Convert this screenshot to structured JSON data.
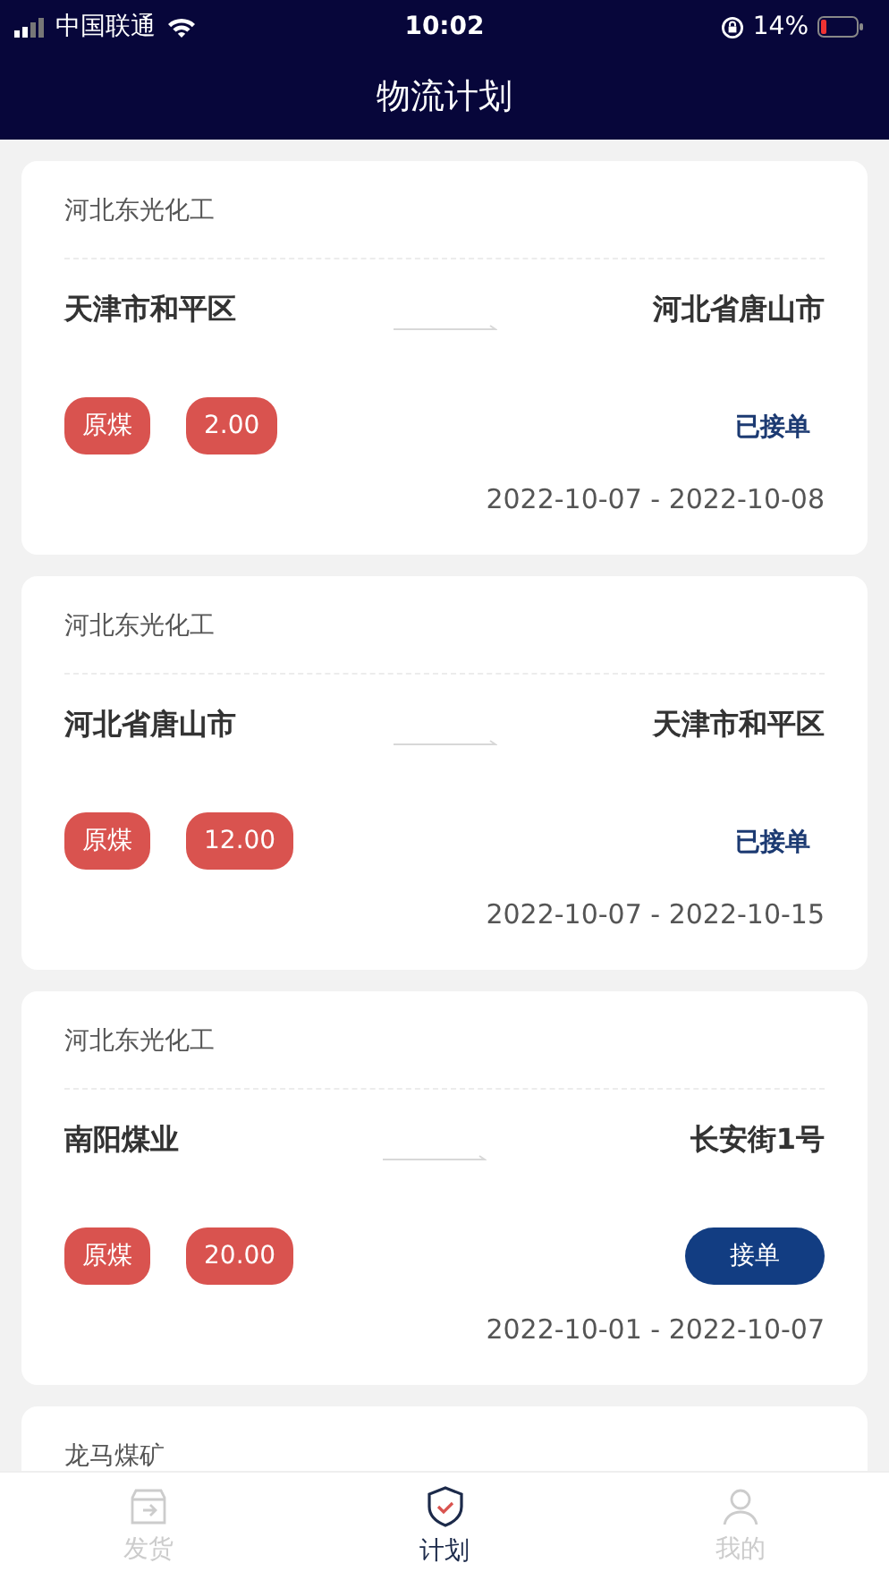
{
  "status_bar": {
    "carrier": "中国联通",
    "time": "10:02",
    "battery": "14%"
  },
  "header": {
    "title": "物流计划"
  },
  "plans": [
    {
      "company": "河北东光化工",
      "origin": "天津市和平区",
      "destination": "河北省唐山市",
      "cargo": "原煤",
      "amount": "2.00",
      "action": {
        "kind": "status",
        "label": "已接单"
      },
      "dates": "2022-10-07 - 2022-10-08"
    },
    {
      "company": "河北东光化工",
      "origin": "河北省唐山市",
      "destination": "天津市和平区",
      "cargo": "原煤",
      "amount": "12.00",
      "action": {
        "kind": "status",
        "label": "已接单"
      },
      "dates": "2022-10-07 - 2022-10-15"
    },
    {
      "company": "河北东光化工",
      "origin": "南阳煤业",
      "destination": "长安街1号",
      "cargo": "原煤",
      "amount": "20.00",
      "action": {
        "kind": "button",
        "label": "接单"
      },
      "dates": "2022-10-01 - 2022-10-07"
    },
    {
      "company": "龙马煤矿"
    }
  ],
  "tab_bar": [
    {
      "label": "发货",
      "selected": false
    },
    {
      "label": "计划",
      "selected": true
    },
    {
      "label": "我的",
      "selected": false
    }
  ]
}
